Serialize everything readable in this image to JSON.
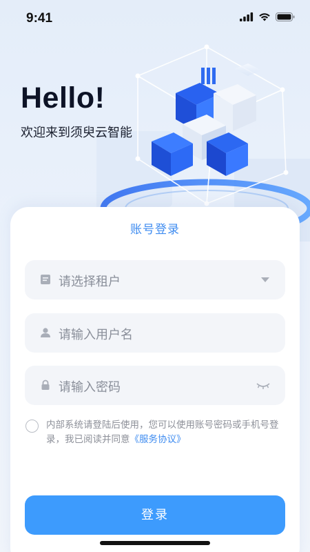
{
  "status": {
    "time": "9:41"
  },
  "hero": {
    "title": "Hello!",
    "subtitle": "欢迎来到须臾云智能"
  },
  "login": {
    "title": "账号登录",
    "tenant_placeholder": "请选择租户",
    "username_placeholder": "请输入用户名",
    "password_placeholder": "请输入密码",
    "agreement_text": "内部系统请登陆后使用，您可以使用账号密码或手机号登录，我已阅读并同意",
    "agreement_link": "《服务协议》",
    "submit_label": "登录"
  },
  "colors": {
    "accent": "#3d9bfd",
    "link": "#3f8cf0"
  }
}
